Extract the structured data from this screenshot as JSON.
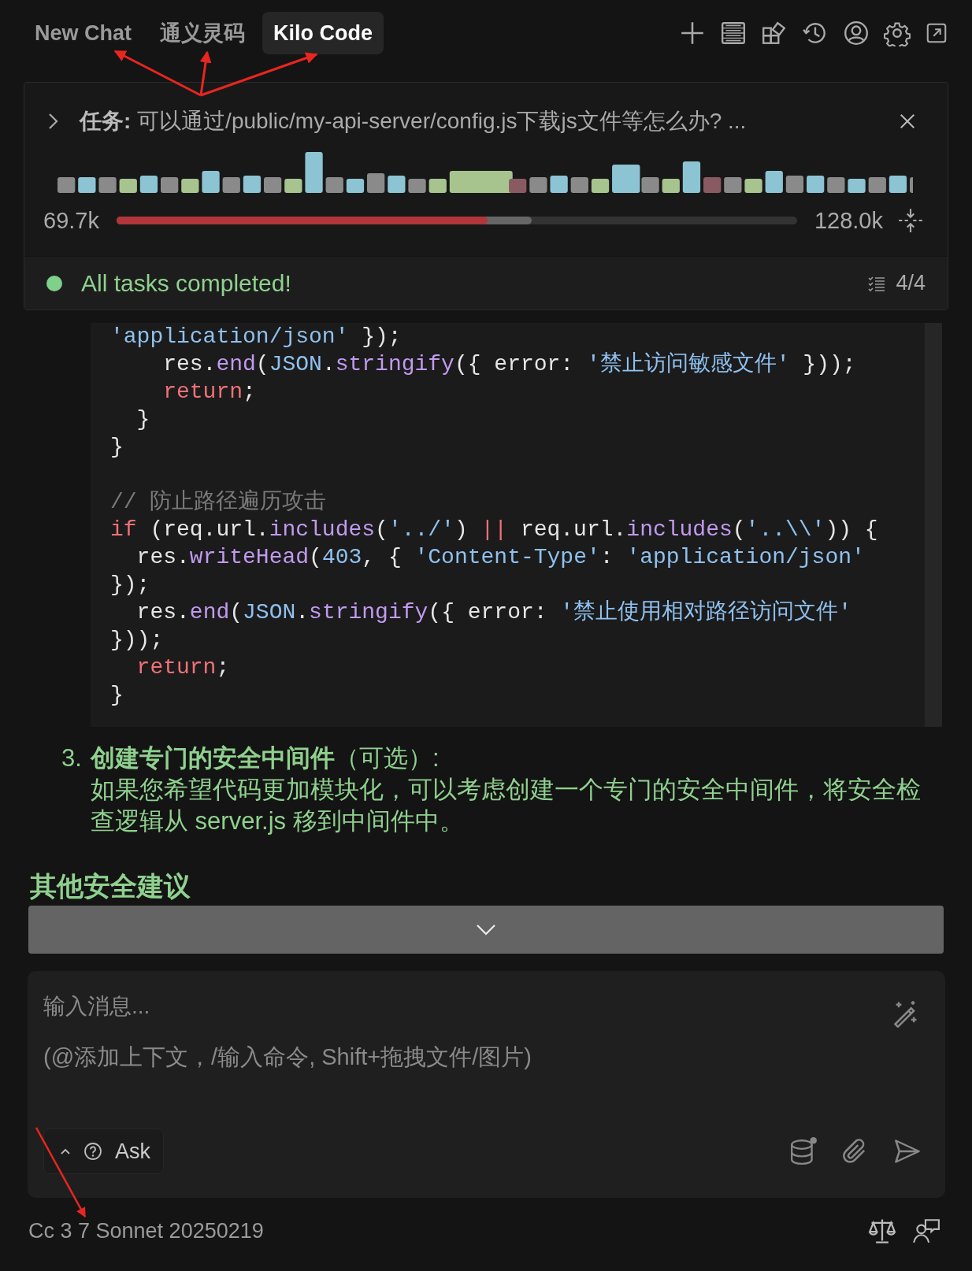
{
  "tabs": [
    {
      "label": "New Chat",
      "selected": false
    },
    {
      "label": "通义灵码",
      "selected": false
    },
    {
      "label": "Kilo Code",
      "selected": true
    }
  ],
  "task": {
    "title": "**任务:** 可以通过/public/my-api-server/config.js下载js文件等怎么办? ...",
    "tokens_used": "69.7k",
    "context_limit": "128.0k",
    "progress": {
      "used": {
        "level": 0.545
      },
      "reserved": {
        "level": 0.61
      }
    }
  },
  "status": {
    "text": "All tasks completed!",
    "done": true,
    "count": "4/4"
  },
  "code_groups": [
    {
      "lines": [
        [
          {
            "kind": "string",
            "text": "'application/json'"
          },
          {
            "kind": "plain",
            "text": " });"
          }
        ],
        [
          {
            "kind": "plain",
            "text": "    res."
          },
          {
            "kind": "method",
            "text": "end"
          },
          {
            "kind": "plain",
            "text": "("
          },
          {
            "kind": "type",
            "text": "JSON"
          },
          {
            "kind": "plain",
            "text": "."
          },
          {
            "kind": "method",
            "text": "stringify"
          },
          {
            "kind": "plain",
            "text": "({ error: "
          },
          {
            "kind": "string",
            "text": "'禁止访问敏感文件'"
          },
          {
            "kind": "plain",
            "text": " }));"
          }
        ],
        [
          {
            "kind": "keyword",
            "text": "    return"
          },
          {
            "kind": "plain",
            "text": ";"
          }
        ],
        [
          {
            "kind": "plain",
            "text": "  }"
          }
        ],
        [
          {
            "kind": "plain",
            "text": "}"
          }
        ]
      ]
    },
    {
      "lines": [
        [
          {
            "kind": "comment",
            "text": "// 防止路径遍历攻击"
          }
        ],
        [
          {
            "kind": "keyword",
            "text": "if"
          },
          {
            "kind": "plain",
            "text": " (req.url."
          },
          {
            "kind": "method",
            "text": "includes"
          },
          {
            "kind": "plain",
            "text": "("
          },
          {
            "kind": "string",
            "text": "'../'"
          },
          {
            "kind": "plain",
            "text": ") "
          },
          {
            "kind": "keyword",
            "text": "||"
          },
          {
            "kind": "plain",
            "text": " req.url."
          },
          {
            "kind": "method",
            "text": "includes"
          },
          {
            "kind": "plain",
            "text": "("
          },
          {
            "kind": "string",
            "text": "'..\\\\'"
          },
          {
            "kind": "plain",
            "text": ")) {"
          }
        ],
        [
          {
            "kind": "plain",
            "text": "  res."
          },
          {
            "kind": "method",
            "text": "writeHead"
          },
          {
            "kind": "plain",
            "text": "("
          },
          {
            "kind": "type",
            "text": "403"
          },
          {
            "kind": "plain",
            "text": ", { "
          },
          {
            "kind": "string",
            "text": "'Content-Type'"
          },
          {
            "kind": "plain",
            "text": ": "
          },
          {
            "kind": "string",
            "text": "'application/json'"
          }
        ],
        [
          {
            "kind": "plain",
            "text": "});"
          }
        ],
        [
          {
            "kind": "plain",
            "text": "  res."
          },
          {
            "kind": "method",
            "text": "end"
          },
          {
            "kind": "plain",
            "text": "("
          },
          {
            "kind": "type",
            "text": "JSON"
          },
          {
            "kind": "plain",
            "text": "."
          },
          {
            "kind": "method",
            "text": "stringify"
          },
          {
            "kind": "plain",
            "text": "({ error: "
          },
          {
            "kind": "string",
            "text": "'禁止使用相对路径访问文件'"
          }
        ],
        [
          {
            "kind": "plain",
            "text": "}));"
          }
        ],
        [
          {
            "kind": "keyword",
            "text": "  return"
          },
          {
            "kind": "plain",
            "text": ";"
          }
        ],
        [
          {
            "kind": "plain",
            "text": "}"
          }
        ]
      ]
    }
  ],
  "step": {
    "number": "3.",
    "title": "**创建专门的安全中间件**（可选）:",
    "body": "如果您希望代码更加模块化，可以考虑创建一个专门的安全中间件，将安全检查逻辑从 server.js 移到中间件中。"
  },
  "heading": "其他安全建议",
  "input": {
    "placeholder": "输入消息...",
    "hint": "(@添加上下文，/输入命令, Shift+拖拽文件/图片)",
    "mode": "Ask"
  },
  "model": "Cc 3 7 Sonnet 20250219"
}
